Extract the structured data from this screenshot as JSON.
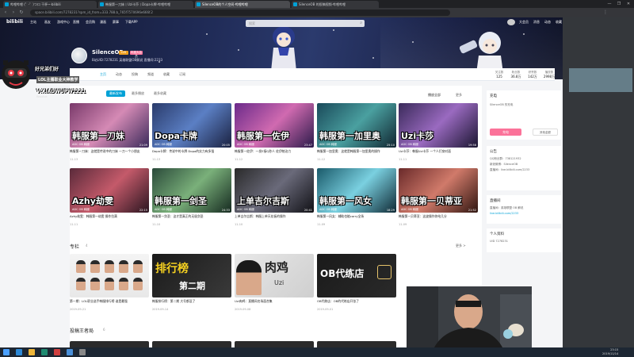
{
  "browser": {
    "tabs": [
      {
        "label": "哔哩哔哩 (゜-゜)つロ 干杯~-bilibili"
      },
      {
        "label": "韩服第一刀妹丨Uzi卡莎丨Dopa卡牌-哔哩哔哩"
      },
      {
        "label": "SilenceOB的个人空间-哔哩哔哩"
      },
      {
        "label": "SilenceOB 的投稿视频-哔哩哔哩"
      }
    ],
    "url": "space.bilibili.com/7278231?spm_id_from=333.788.b_765f7570696e666f.2",
    "window_controls": [
      "—",
      "❐",
      "✕"
    ]
  },
  "nav": {
    "logo": "bilibili",
    "links": [
      "主站",
      "画友",
      "游戏中心",
      "直播",
      "会员购",
      "漫画",
      "赛事",
      "下载APP"
    ],
    "search_placeholder": "搜索",
    "right_links": [
      "大会员",
      "消息",
      "动态",
      "收藏",
      "历史",
      "创作中心"
    ],
    "upload_label": "投稿"
  },
  "profile": {
    "name": "SilenceOB",
    "level": "LV6",
    "vip": "年度大会员",
    "sign": "B站UID:7278231 英雄联盟OB解说 直播间:2233",
    "tabs": [
      "主页",
      "动态",
      "投稿",
      "频道",
      "收藏",
      "订阅"
    ],
    "active_tab": "主页",
    "stats": [
      {
        "k": "关注数",
        "v": "125"
      },
      {
        "k": "粉丝数",
        "v": "36.8万"
      },
      {
        "k": "获赞数",
        "v": "142万"
      },
      {
        "k": "播放数",
        "v": "2998万"
      }
    ]
  },
  "videos": {
    "subtabs": [
      "最新发布",
      "最多播放",
      "最多收藏"
    ],
    "active_subtab": "最新发布",
    "sort_play": "播放全部",
    "sort_more": "更多",
    "items": [
      {
        "big": "韩服第一刀妹",
        "small": "ADC OB 韩服",
        "dur": "21:09",
        "title": "韩服第一刀妹：这就是传说中的刀妹 一刀一个小朋友",
        "date": "11-13",
        "bg": "linear-gradient(135deg,#7a3a6b,#d58ab5 50%,#3a2a5a)"
      },
      {
        "big": "Dopa卡牌",
        "small": "ADC OB 韩服",
        "dur": "20:05",
        "title": "Dopa卡牌：传说中的卡牌 Dopa的实力有多强",
        "date": "11-13",
        "bg": "linear-gradient(135deg,#2a3b6b,#5b7fc4 50%,#1a2140)"
      },
      {
        "big": "韩服第一佐伊",
        "small": "ADC OB 韩服",
        "dur": "23:47",
        "title": "韩服第一佐伊：一发E接Q秒人 佐伊统治力",
        "date": "11-12",
        "bg": "linear-gradient(135deg,#6b2a8a,#d06ab0 50%,#2b1a4a)"
      },
      {
        "big": "韩服第一加里奥",
        "small": "ADC OB 韩服",
        "dur": "25:10",
        "title": "韩服第一加里奥：这就是韩服第一加里奥的操作",
        "date": "11-12",
        "bg": "linear-gradient(135deg,#1a4a5a,#4aa0a0 50%,#102530)"
      },
      {
        "big": "Uzi卡莎",
        "small": "ADC OB 韩服",
        "dur": "19:58",
        "title": "Uzi卡莎：韩服Uzi卡莎 一个人打穿对面",
        "date": "11-11",
        "bg": "linear-gradient(135deg,#3a2a5a,#9a6ac0 50%,#1a1530)"
      },
      {
        "big": "Azhy劫雯",
        "small": "ADC OB 韩服",
        "dur": "22:15",
        "title": "Azhy劫雯：韩服第一劫雯 操作拉满",
        "date": "11-11",
        "bg": "linear-gradient(135deg,#5a2a3a,#c45a6a 50%,#2a1520)"
      },
      {
        "big": "韩服第一剑圣",
        "small": "ADC OB 韩服",
        "dur": "24:33",
        "title": "韩服第一剑圣：这才是真正的无极剑圣",
        "date": "11-10",
        "bg": "linear-gradient(135deg,#2a4a3a,#7ab07a 50%,#152a20)"
      },
      {
        "big": "上单吉尔吉斯",
        "small": "ADC OB 韩服",
        "dur": "20:41",
        "title": "上单吉尔吉斯：韩服上单天花板的操作",
        "date": "11-10",
        "bg": "linear-gradient(135deg,#2a2a2a,#6a6a7a 50%,#101015)"
      },
      {
        "big": "韩服第一风女",
        "small": "ADC OB 韩服",
        "dur": "18:29",
        "title": "韩服第一风女：辅助也能carry全场",
        "date": "11-09",
        "bg": "linear-gradient(135deg,#1a5a6a,#7ad0e0 50%,#0f2a35)"
      },
      {
        "big": "韩服第一贝蒂亚",
        "small": "ADC OB 韩服",
        "dur": "21:52",
        "title": "韩服第一贝蒂亚：这波操作你给几分",
        "date": "11-09",
        "bg": "linear-gradient(135deg,#6a2a2a,#d07a6a 50%,#301510)"
      }
    ]
  },
  "columns": {
    "title": "专栏",
    "count": "4",
    "more": "更多 >",
    "items": [
      {
        "label": "",
        "title": "第一期：LOL职业选手韩服排行榜 谁是最强",
        "date": "2019-09-21",
        "bg": "linear-gradient(180deg,#f4f4f4,#e8e8e8)"
      },
      {
        "label": "排行榜",
        "sub": "第二期",
        "title": "韩服排行榜：第二期 大号都没了",
        "date": "2019-09-14",
        "bg": "linear-gradient(135deg,#1a1a1a,#3a3a3a)"
      },
      {
        "label": "肉鸡",
        "sub": "Uzi",
        "title": "Uzi肉鸡：直播间名场面合集",
        "date": "2019-09-08",
        "bg": "linear-gradient(135deg,#e8e8e8,#cfcfcf)"
      },
      {
        "label": "OB代练店",
        "sub": "",
        "title": "OB代练店：OB的代练店开张了",
        "date": "2019-09-01",
        "bg": "linear-gradient(135deg,#1a1a1a,#2a2a2a)"
      }
    ]
  },
  "section3": {
    "title": "投稿王者局",
    "count": "6"
  },
  "sidebar": {
    "charge_title": "充电",
    "charge_desc": "SilenceOB 的充电",
    "charge_btn": "充电",
    "charge_other": "其他金额",
    "notice_title": "公告",
    "notice_lines": [
      "QQ粉丝群：738121932",
      "新浪微博：SilenceOB",
      "直播间：live.bilibili.com/2233"
    ],
    "tag_title": "直播间",
    "tag_lines": [
      "直播间：英雄联盟 OB 解说",
      "live.bilibili.com/2233"
    ],
    "info_title": "个人资料",
    "info_lines": [
      "UID 7278231"
    ]
  },
  "overlay": {
    "line1": "好兄弟们好",
    "line2": "LOL主播职业大神教学",
    "line3": "V:XIADWUPW1221",
    "line4": "Resolve"
  },
  "taskbar": {
    "time": "23:15",
    "date": "2019/11/14"
  },
  "colors": {
    "accent": "#00a1d6",
    "pink": "#fb7299",
    "banner": "#1f2a55"
  }
}
